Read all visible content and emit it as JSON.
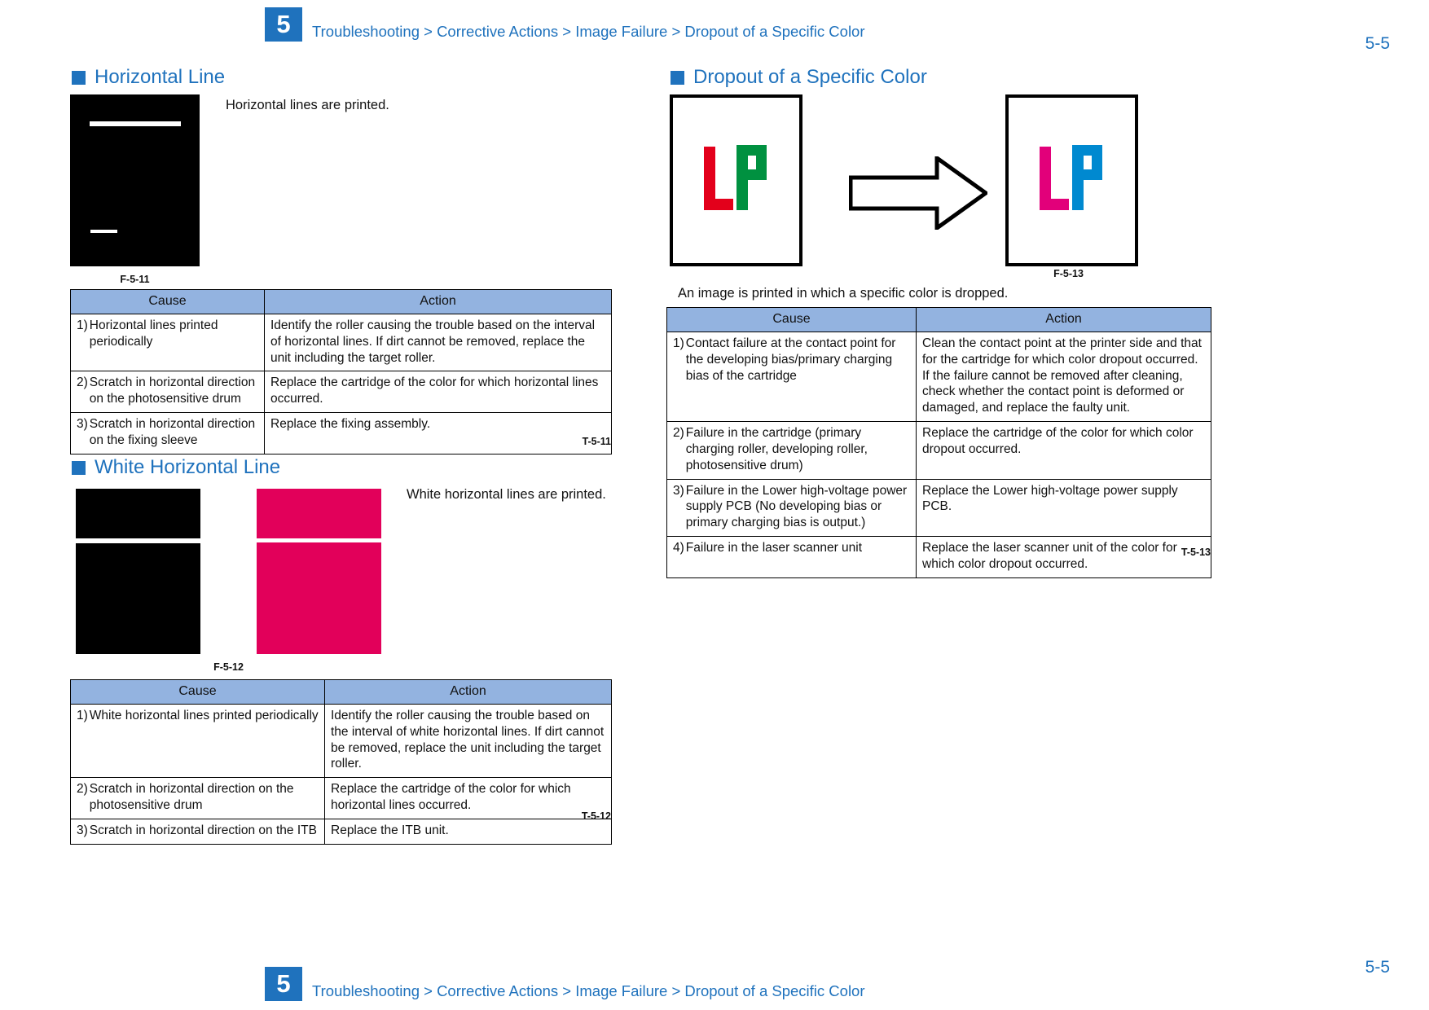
{
  "header": {
    "chapter": "5",
    "breadcrumb": "Troubleshooting > Corrective Actions > Image Failure > Dropout of a Specific Color",
    "page_number": "5-5"
  },
  "footer": {
    "chapter": "5",
    "breadcrumb": "Troubleshooting > Corrective Actions > Image Failure > Dropout of a Specific Color",
    "page_number": "5-5"
  },
  "colors": {
    "accent_blue": "#1f72bd",
    "table_header_blue": "#93b3e0",
    "magenta": "#e2005a",
    "sample_red": "#e3001b",
    "sample_green": "#009140",
    "sample_magenta": "#e2007a",
    "sample_cyan": "#0089d0"
  },
  "sections": [
    {
      "id": "horizontal-line",
      "title": "Horizontal Line",
      "description": "Horizontal lines are printed.",
      "figure_caption": "F-5-11",
      "table_caption": "T-5-11",
      "table": {
        "headers": [
          "Cause",
          "Action"
        ],
        "rows": [
          {
            "num": "1)",
            "cause": "Horizontal lines printed periodically",
            "action": "Identify the roller causing the trouble based on the interval of horizontal lines. If dirt cannot be removed, replace the unit including the target roller."
          },
          {
            "num": "2)",
            "cause": "Scratch in horizontal direction on the photosensitive drum",
            "action": "Replace the cartridge of the color for which horizontal lines occurred."
          },
          {
            "num": "3)",
            "cause": "Scratch in horizontal direction on the fixing sleeve",
            "action": "Replace the fixing assembly."
          }
        ]
      }
    },
    {
      "id": "white-horizontal-line",
      "title": "White Horizontal Line",
      "description": "White horizontal lines are printed.",
      "figure_caption": "F-5-12",
      "table_caption": "T-5-12",
      "table": {
        "headers": [
          "Cause",
          "Action"
        ],
        "rows": [
          {
            "num": "1)",
            "cause": "White horizontal lines printed periodically",
            "action": "Identify the roller causing the trouble based on the interval of white horizontal lines. If dirt cannot be removed, replace the unit including the target roller."
          },
          {
            "num": "2)",
            "cause": "Scratch in horizontal direction on the photosensitive drum",
            "action": "Replace the cartridge of the color for which horizontal lines occurred."
          },
          {
            "num": "3)",
            "cause": "Scratch in horizontal direction on the ITB",
            "action": "Replace the ITB unit."
          }
        ]
      }
    },
    {
      "id": "dropout-of-a-specific-color",
      "title": "Dropout of a Specific Color",
      "description": "An image is printed in which a specific color is dropped.",
      "figure_caption": "F-5-13",
      "table_caption": "T-5-13",
      "figure": {
        "before_letters": "LP",
        "after_letters": "LP",
        "transition_icon": "right-arrow-icon"
      },
      "table": {
        "headers": [
          "Cause",
          "Action"
        ],
        "rows": [
          {
            "num": "1)",
            "cause": "Contact failure at the contact point for the developing bias/primary charging bias of the cartridge",
            "action": "Clean the contact point at the printer side and that for the cartridge for which color dropout occurred. If the failure cannot be removed after cleaning, check whether the contact point is deformed or damaged, and replace the faulty unit."
          },
          {
            "num": "2)",
            "cause": "Failure in the cartridge (primary charging roller, developing roller, photosensitive drum)",
            "action": "Replace the cartridge of the color for which color dropout occurred."
          },
          {
            "num": "3)",
            "cause": "Failure in the Lower high-voltage power supply PCB (No developing bias or primary charging bias is output.)",
            "action": "Replace the Lower high-voltage power supply PCB."
          },
          {
            "num": "4)",
            "cause": "Failure in the laser scanner unit",
            "action": "Replace the laser scanner unit of the color for which color dropout occurred."
          }
        ]
      }
    }
  ]
}
